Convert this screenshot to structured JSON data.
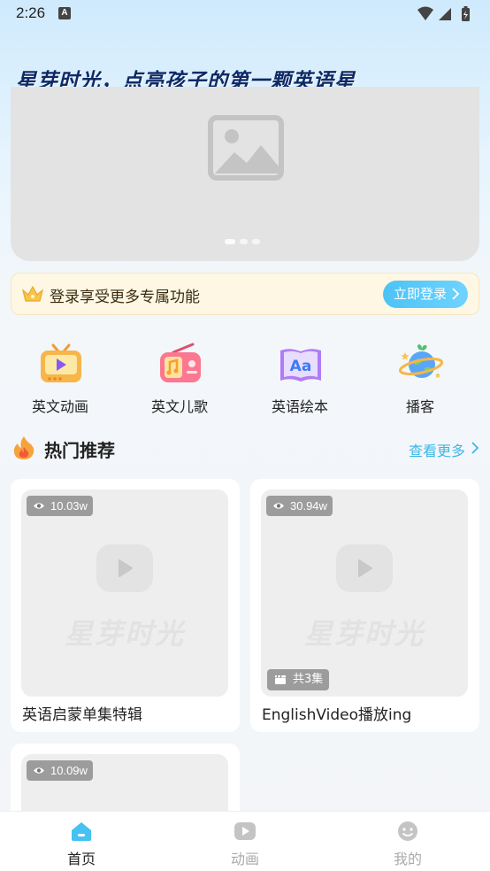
{
  "status_bar": {
    "time": "2:26",
    "notification_letter": "A"
  },
  "headline": "星芽时光，点亮孩子的第一颗英语星",
  "banner": {
    "dots": 3,
    "active_dot": 0
  },
  "login_bar": {
    "text": "登录享受更多专属功能",
    "button_label": "立即登录"
  },
  "categories": [
    {
      "label": "英文动画",
      "icon": "tv-icon"
    },
    {
      "label": "英文儿歌",
      "icon": "radio-icon"
    },
    {
      "label": "英语绘本",
      "icon": "book-icon"
    },
    {
      "label": "播客",
      "icon": "planet-icon"
    }
  ],
  "section": {
    "title": "热门推荐",
    "see_more": "查看更多"
  },
  "cards": [
    {
      "views": "10.03w",
      "title": "英语启蒙单集特辑",
      "watermark": "星芽时光"
    },
    {
      "views": "30.94w",
      "title": "EnglishVideo播放ing",
      "episodes": "共3集",
      "watermark": "星芽时光"
    },
    {
      "views": "10.09w"
    }
  ],
  "tabs": [
    {
      "label": "首页",
      "icon": "home-icon"
    },
    {
      "label": "动画",
      "icon": "video-icon"
    },
    {
      "label": "我的",
      "icon": "smiley-icon"
    }
  ],
  "colors": {
    "accent": "#3db7e8",
    "headline": "#0d2a66",
    "active_tab": "#45c2f2"
  }
}
